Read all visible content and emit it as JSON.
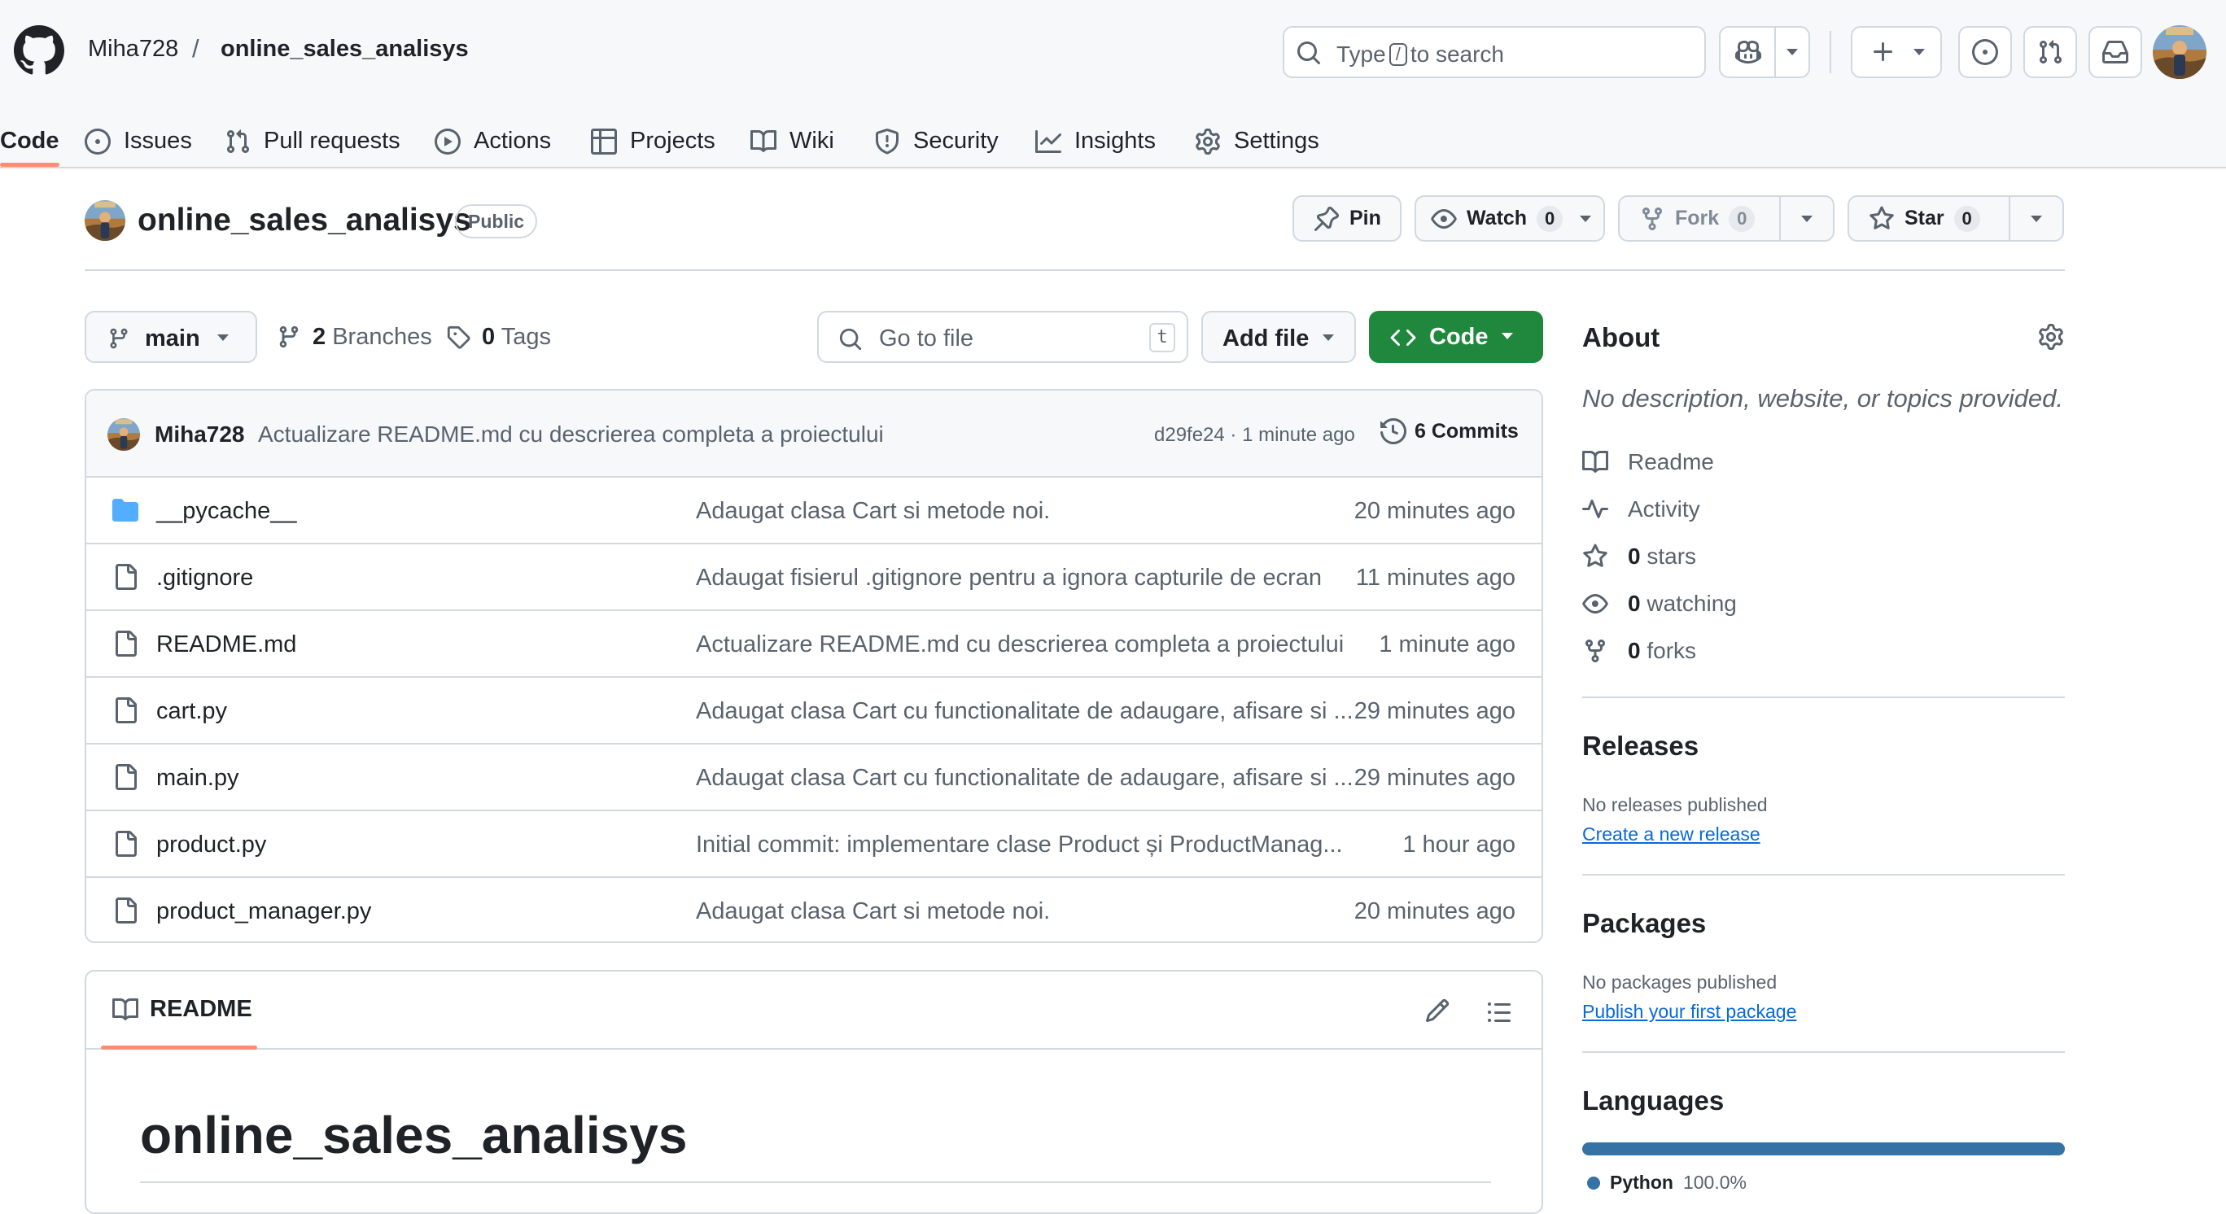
{
  "header": {
    "owner": "Miha728",
    "separator": "/",
    "repo": "online_sales_analisys",
    "search": {
      "before": "Type",
      "key": "/",
      "after": "to search"
    },
    "icons": [
      "github-logo-icon",
      "copilot-icon",
      "plus-icon",
      "issue-opened-icon",
      "pull-request-icon",
      "inbox-icon"
    ]
  },
  "tabs": [
    {
      "label": "Code",
      "icon": "code-icon"
    },
    {
      "label": "Issues",
      "icon": "issue-opened-icon"
    },
    {
      "label": "Pull requests",
      "icon": "pull-request-icon"
    },
    {
      "label": "Actions",
      "icon": "play-icon"
    },
    {
      "label": "Projects",
      "icon": "table-icon"
    },
    {
      "label": "Wiki",
      "icon": "book-icon"
    },
    {
      "label": "Security",
      "icon": "shield-icon"
    },
    {
      "label": "Insights",
      "icon": "graph-icon"
    },
    {
      "label": "Settings",
      "icon": "gear-icon"
    }
  ],
  "repo": {
    "name": "online_sales_analisys",
    "visibility": "Public",
    "actions": {
      "pin": "Pin",
      "watch": "Watch",
      "watch_count": "0",
      "fork": "Fork",
      "fork_count": "0",
      "star": "Star",
      "star_count": "0"
    }
  },
  "filenav": {
    "branch": "main",
    "branches_count": "2",
    "branches_label": "Branches",
    "tags_count": "0",
    "tags_label": "Tags",
    "goto_placeholder": "Go to file",
    "goto_key": "t",
    "add_file": "Add file",
    "code": "Code"
  },
  "latest_commit": {
    "author": "Miha728",
    "message": "Actualizare README.md cu descrierea completa a proiectului",
    "sha_time": "d29fe24 · 1 minute ago",
    "commits_count": "6",
    "commits_label": "Commits"
  },
  "files": [
    {
      "name": "__pycache__",
      "type": "folder",
      "message": "Adaugat clasa Cart si metode noi.",
      "age": "20 minutes ago"
    },
    {
      "name": ".gitignore",
      "type": "file",
      "message": "Adaugat fisierul .gitignore pentru a ignora capturile de ecran",
      "age": "11 minutes ago"
    },
    {
      "name": "README.md",
      "type": "file",
      "message": "Actualizare README.md cu descrierea completa a proiectului",
      "age": "1 minute ago"
    },
    {
      "name": "cart.py",
      "type": "file",
      "message": "Adaugat clasa Cart cu functionalitate de adaugare, afisare si ...",
      "age": "29 minutes ago"
    },
    {
      "name": "main.py",
      "type": "file",
      "message": "Adaugat clasa Cart cu functionalitate de adaugare, afisare si ...",
      "age": "29 minutes ago"
    },
    {
      "name": "product.py",
      "type": "file",
      "message": "Initial commit: implementare clase Product și ProductManag...",
      "age": "1 hour ago"
    },
    {
      "name": "product_manager.py",
      "type": "file",
      "message": "Adaugat clasa Cart si metode noi.",
      "age": "20 minutes ago"
    }
  ],
  "readme": {
    "tab_label": "README",
    "title": "online_sales_analisys"
  },
  "about": {
    "heading": "About",
    "description": "No description, website, or topics provided.",
    "readme": "Readme",
    "activity": "Activity",
    "stars_count": "0",
    "stars_label": "stars",
    "watching_count": "0",
    "watching_label": "watching",
    "forks_count": "0",
    "forks_label": "forks"
  },
  "releases": {
    "heading": "Releases",
    "empty": "No releases published",
    "link": "Create a new release"
  },
  "packages": {
    "heading": "Packages",
    "empty": "No packages published",
    "link": "Publish your first package"
  },
  "languages": {
    "heading": "Languages",
    "items": [
      {
        "name": "Python",
        "percent": "100.0%",
        "fraction": 1.0,
        "color": "#3572a5"
      }
    ]
  },
  "colors": {
    "accent_green": "#1f883d",
    "tab_underline": "#fd8c73",
    "link_blue": "#0969da",
    "folder_blue": "#54aeff",
    "python": "#3572a5"
  }
}
